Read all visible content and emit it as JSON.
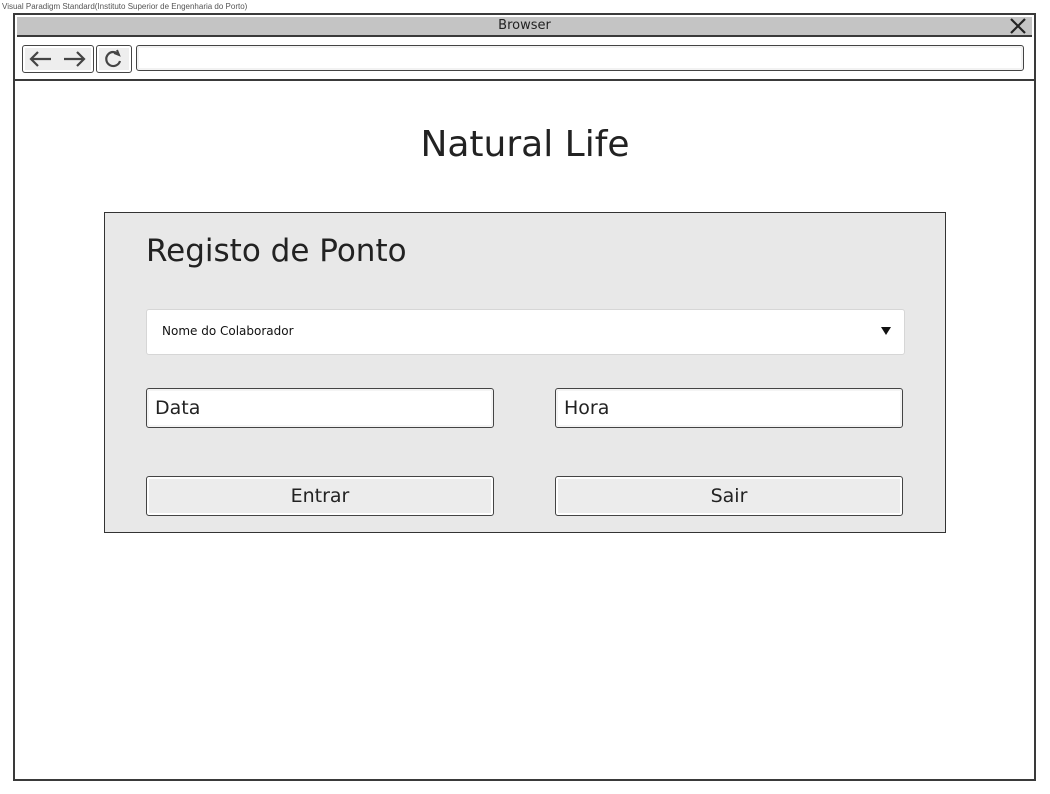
{
  "watermark": "Visual Paradigm Standard(Instituto Superior de Engenharia do Porto)",
  "browser": {
    "title": "Browser",
    "close_icon": "close-icon",
    "back_icon": "arrow-left-icon",
    "forward_icon": "arrow-right-icon",
    "reload_icon": "reload-icon",
    "address_value": ""
  },
  "page": {
    "site_title": "Natural Life"
  },
  "form": {
    "title": "Registo de Ponto",
    "employee_select": "Nome do Colaborador",
    "date_placeholder": "Data",
    "time_placeholder": "Hora",
    "enter_label": "Entrar",
    "exit_label": "Sair"
  }
}
